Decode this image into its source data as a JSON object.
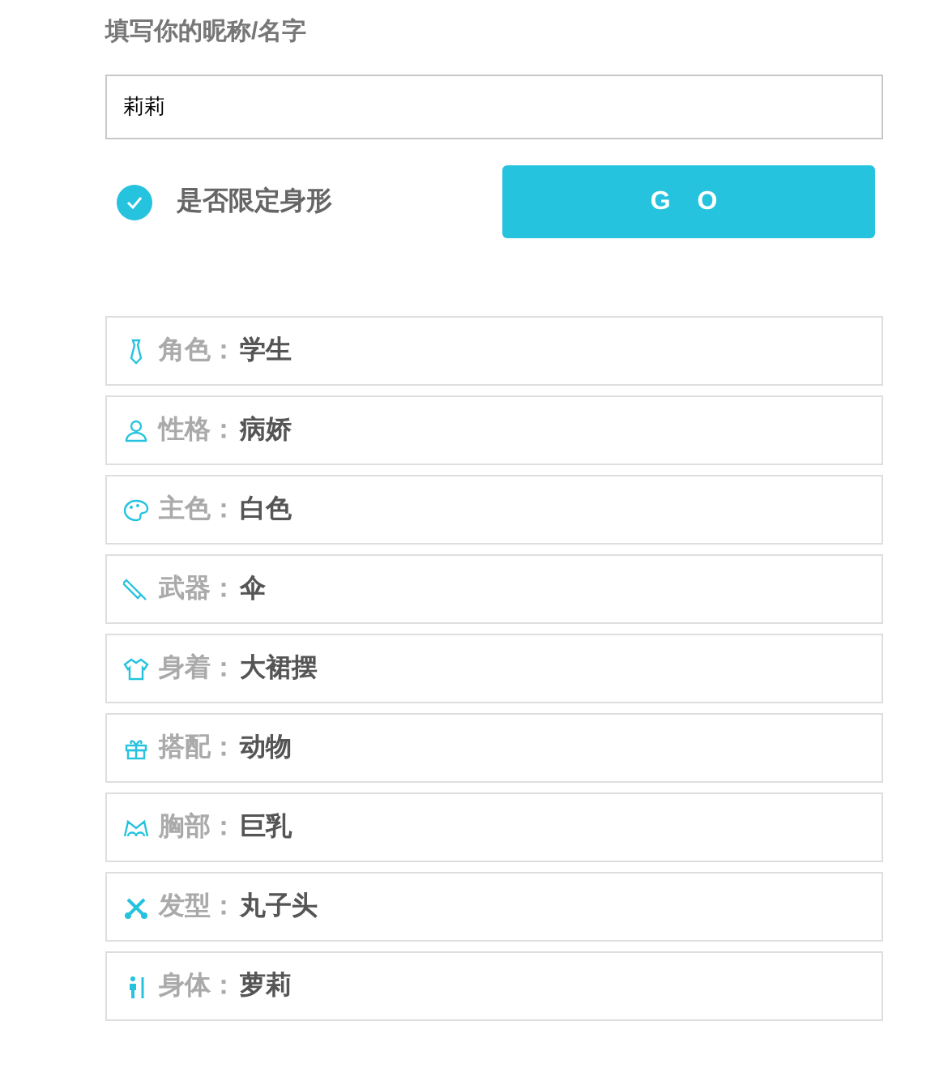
{
  "name_field": {
    "label": "填写你的昵称/名字",
    "value": "莉莉"
  },
  "body_limit": {
    "label": "是否限定身形",
    "checked": true
  },
  "go_button": "G O",
  "attributes": [
    {
      "label": "角色：",
      "value": "学生"
    },
    {
      "label": "性格：",
      "value": "病娇"
    },
    {
      "label": "主色：",
      "value": "白色"
    },
    {
      "label": "武器：",
      "value": "伞"
    },
    {
      "label": "身着：",
      "value": "大裙摆"
    },
    {
      "label": "搭配：",
      "value": "动物"
    },
    {
      "label": "胸部：",
      "value": "巨乳"
    },
    {
      "label": "发型：",
      "value": "丸子头"
    },
    {
      "label": "身体：",
      "value": "萝莉"
    }
  ]
}
